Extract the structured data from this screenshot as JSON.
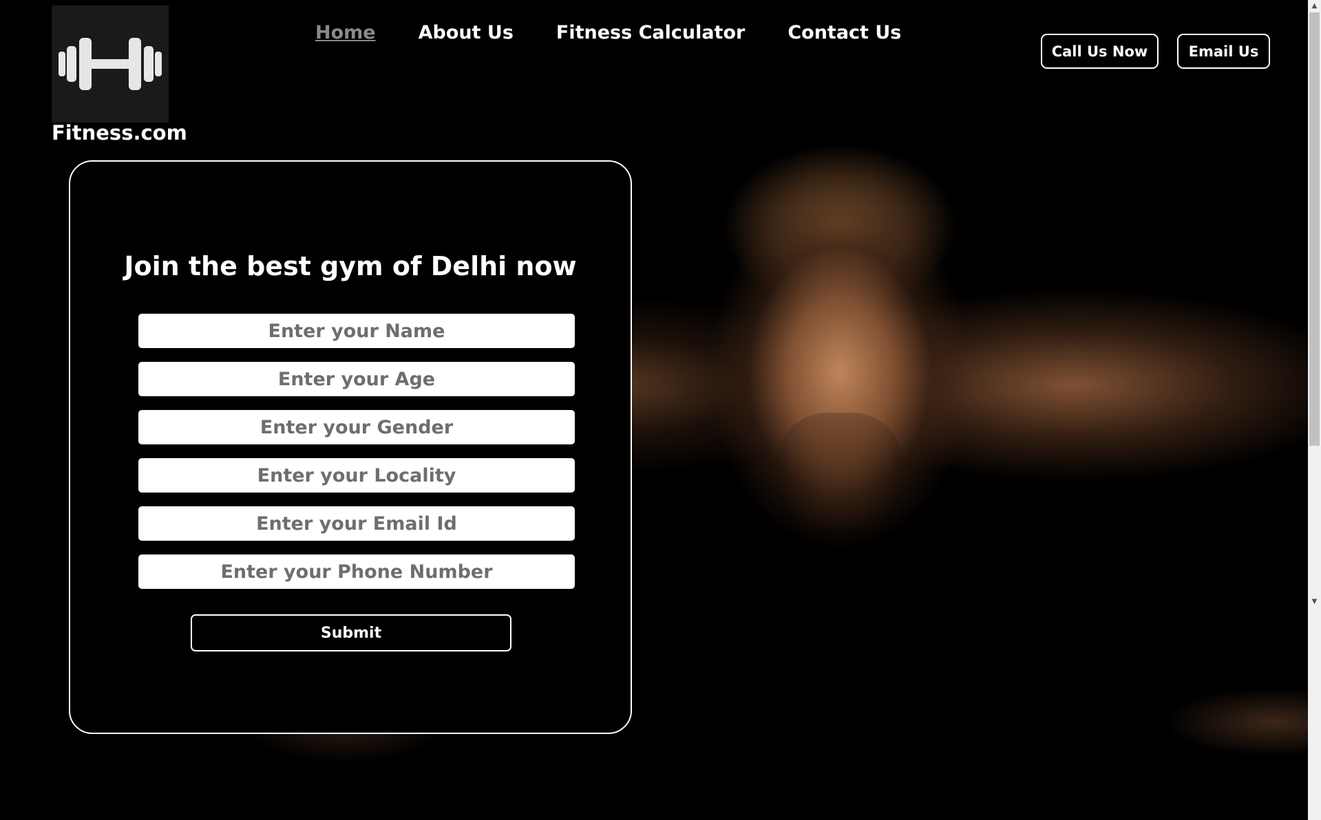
{
  "brand": {
    "name": "Fitness.com",
    "logo_icon": "dumbbell-icon"
  },
  "nav": {
    "items": [
      {
        "label": "Home",
        "active": true
      },
      {
        "label": "About Us",
        "active": false
      },
      {
        "label": "Fitness Calculator",
        "active": false
      },
      {
        "label": "Contact Us",
        "active": false
      }
    ]
  },
  "header_buttons": {
    "call_label": "Call Us Now",
    "email_label": "Email Us"
  },
  "form": {
    "title": "Join the best gym of Delhi now",
    "fields": [
      {
        "placeholder": "Enter your Name",
        "value": ""
      },
      {
        "placeholder": "Enter your Age",
        "value": ""
      },
      {
        "placeholder": "Enter your Gender",
        "value": ""
      },
      {
        "placeholder": "Enter your Locality",
        "value": ""
      },
      {
        "placeholder": "Enter your Email Id",
        "value": ""
      },
      {
        "placeholder": "Enter your Phone Number",
        "value": ""
      }
    ],
    "submit_label": "Submit"
  },
  "colors": {
    "background": "#000000",
    "text": "#ffffff",
    "nav_active": "#8a8a8a",
    "placeholder": "#6e6e6e"
  }
}
